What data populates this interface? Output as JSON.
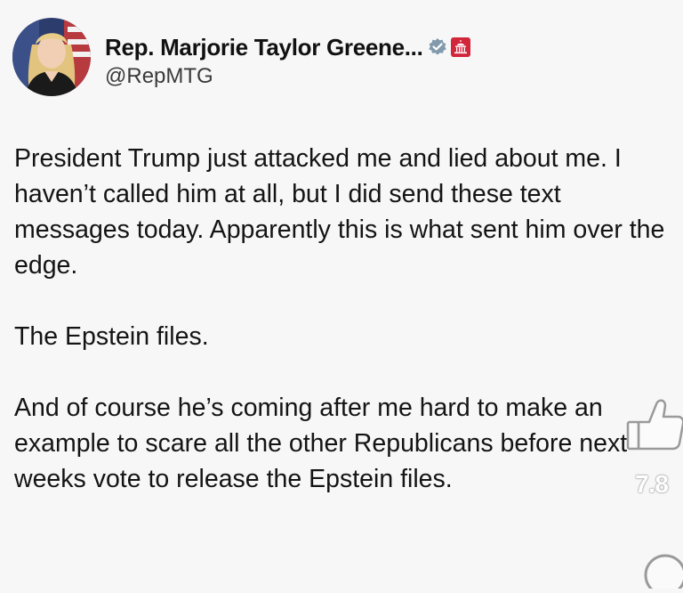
{
  "tweet": {
    "author": {
      "display_name": "Rep. Marjorie Taylor Greene...",
      "handle": "@RepMTG",
      "verified_badge_icon": "verified-badge-icon",
      "government_badge_icon": "capitol-building-icon"
    },
    "paragraphs": [
      "President Trump just attacked me and lied about me. I haven’t called him at all, but I did send these text messages today. Apparently this is what sent him over the edge.",
      "The Epstein files.",
      "And of course he’s coming after me hard to make an example to scare all the other Republicans before next weeks vote to release the Epstein files."
    ]
  },
  "overlay": {
    "like_icon": "thumbs-up-icon",
    "like_count": "7.8",
    "comment_icon": "comment-bubble-icon"
  },
  "colors": {
    "background": "#f7f7f8",
    "text": "#141414",
    "verified_badge": "#829aab",
    "gov_badge": "#d2263b"
  }
}
